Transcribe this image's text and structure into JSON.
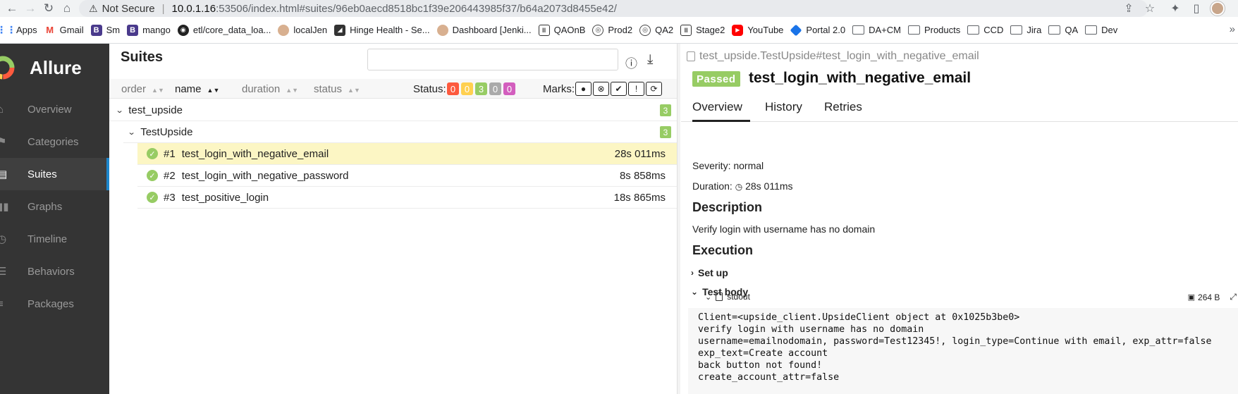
{
  "browser": {
    "security_label": "Not Secure",
    "url_host": "10.0.1.16",
    "url_path": ":53506/index.html#suites/96eb0aecd8518bc1f39e206443985f37/b64a2073d8455e42/",
    "bookmarks": [
      {
        "label": "Apps",
        "icon": "apps-grid-icon"
      },
      {
        "label": "Gmail",
        "icon": "gmail-icon"
      },
      {
        "label": "Sm",
        "icon": "b-icon"
      },
      {
        "label": "mango",
        "icon": "b-icon"
      },
      {
        "label": "etl/core_data_loa...",
        "icon": "github-icon"
      },
      {
        "label": "localJen",
        "icon": "jenkins-icon"
      },
      {
        "label": "Hinge Health - Se...",
        "icon": "hinge-icon"
      },
      {
        "label": "Dashboard [Jenki...",
        "icon": "jenkins-icon"
      },
      {
        "label": "QAOnB",
        "icon": "qa-icon"
      },
      {
        "label": "Prod2",
        "icon": "globe-icon"
      },
      {
        "label": "QA2",
        "icon": "globe-icon"
      },
      {
        "label": "Stage2",
        "icon": "qa-icon"
      },
      {
        "label": "YouTube",
        "icon": "youtube-icon"
      },
      {
        "label": "Portal 2.0",
        "icon": "portal-icon"
      },
      {
        "label": "DA+CM",
        "icon": "folder-icon"
      },
      {
        "label": "Products",
        "icon": "folder-icon"
      },
      {
        "label": "CCD",
        "icon": "folder-icon"
      },
      {
        "label": "Jira",
        "icon": "folder-icon"
      },
      {
        "label": "QA",
        "icon": "folder-icon"
      },
      {
        "label": "Dev",
        "icon": "folder-icon"
      }
    ]
  },
  "sidebar": {
    "brand": "Allure",
    "items": [
      {
        "label": "Overview",
        "icon": "home-icon"
      },
      {
        "label": "Categories",
        "icon": "flag-icon"
      },
      {
        "label": "Suites",
        "icon": "briefcase-icon"
      },
      {
        "label": "Graphs",
        "icon": "bar-chart-icon"
      },
      {
        "label": "Timeline",
        "icon": "clock-icon"
      },
      {
        "label": "Behaviors",
        "icon": "list-icon"
      },
      {
        "label": "Packages",
        "icon": "align-left-icon"
      }
    ]
  },
  "suites": {
    "title": "Suites",
    "search_value": "",
    "sort": {
      "order": "order",
      "name": "name",
      "duration": "duration",
      "status": "status"
    },
    "status_label": "Status:",
    "status_counts": [
      {
        "value": "0",
        "color": "#fd5a3e"
      },
      {
        "value": "0",
        "color": "#ffd050"
      },
      {
        "value": "3",
        "color": "#97cc64"
      },
      {
        "value": "0",
        "color": "#aaaaaa"
      },
      {
        "value": "0",
        "color": "#d35ebe"
      }
    ],
    "marks_label": "Marks:",
    "tree": {
      "suite": {
        "name": "test_upside",
        "count": "3"
      },
      "class": {
        "name": "TestUpside",
        "count": "3"
      },
      "tests": [
        {
          "num": "#1",
          "name": "test_login_with_negative_email",
          "duration": "28s 011ms"
        },
        {
          "num": "#2",
          "name": "test_login_with_negative_password",
          "duration": "8s 858ms"
        },
        {
          "num": "#3",
          "name": "test_positive_login",
          "duration": "18s 865ms"
        }
      ]
    }
  },
  "detail": {
    "breadcrumb": "test_upside.TestUpside#test_login_with_negative_email",
    "status": "Passed",
    "name": "test_login_with_negative_email",
    "tabs": [
      "Overview",
      "History",
      "Retries"
    ],
    "severity": "Severity: normal",
    "duration_label": "Duration:",
    "duration": "28s 011ms",
    "description_title": "Description",
    "description": "Verify login with username has no domain",
    "execution_title": "Execution",
    "setup_label": "Set up",
    "body_label": "Test body",
    "attachment_name": "stdout",
    "attachment_size": "264 B",
    "stdout": "Client=<upside_client.UpsideClient object at 0x1025b3be0>\nverify login with username has no domain\nusername=emailnodomain, password=Test12345!, login_type=Continue with email, exp_attr=false\nexp_text=Create account\nback button not found!\ncreate_account_attr=false"
  }
}
